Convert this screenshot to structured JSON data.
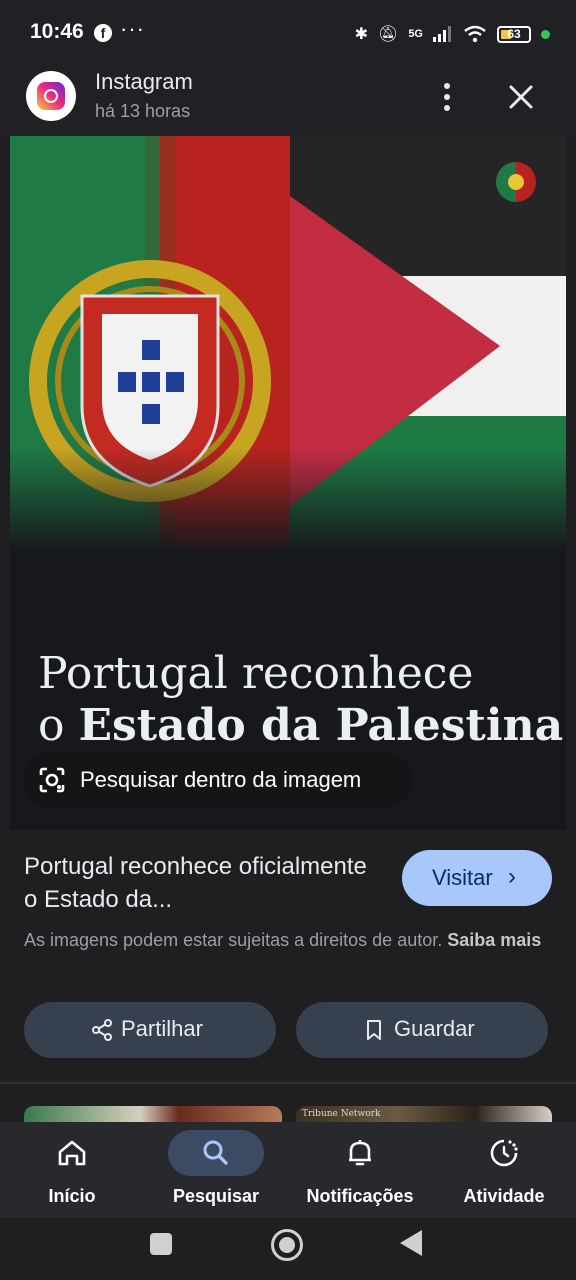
{
  "status_bar": {
    "time": "10:46",
    "network": "5G",
    "battery": "63"
  },
  "header": {
    "app_name": "Instagram",
    "subtitle": "há 13 horas"
  },
  "image": {
    "headline_line1": "Portugal reconhece",
    "headline_line2_prefix": "o ",
    "headline_line2_bold": "Estado da Palestina",
    "lens_label": "Pesquisar dentro da imagem"
  },
  "result": {
    "title": "Portugal reconhece oficialmente o Estado da...",
    "visit_label": "Visitar",
    "copyright_text": "As imagens podem estar sujeitas a direitos de autor.",
    "learn_more": "Saiba mais"
  },
  "actions": {
    "share_label": "Partilhar",
    "save_label": "Guardar"
  },
  "related": {
    "watermark": "Tribune Network"
  },
  "bottom_nav": [
    {
      "label": "Início",
      "icon": "home-icon"
    },
    {
      "label": "Pesquisar",
      "icon": "search-icon",
      "active": true
    },
    {
      "label": "Notificações",
      "icon": "bell-icon"
    },
    {
      "label": "Atividade",
      "icon": "activity-icon"
    }
  ],
  "colors": {
    "accent": "#a8c7fa",
    "background": "#1f1f22",
    "pill": "#37404f"
  }
}
